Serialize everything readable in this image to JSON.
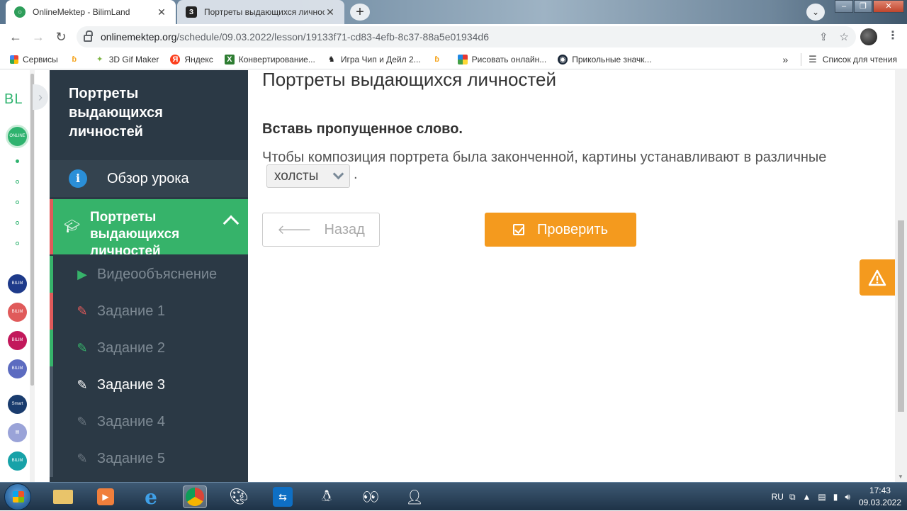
{
  "browser": {
    "tabs": [
      {
        "title": "OnlineMektep - BilimLand",
        "favicon": "onlinemektep-icon",
        "active": true
      },
      {
        "title": "Портреты выдающихся личносте",
        "favicon": "bilimland-icon",
        "active": false
      }
    ],
    "url_host": "onlinemektep.org",
    "url_path": "/schedule/09.03.2022/lesson/19133f71-cd83-4efb-8c37-88a5e01934d6",
    "bookmarks": [
      {
        "label": "Сервисы",
        "icon": "apps-grid-icon"
      },
      {
        "label": "",
        "icon": "bookmark-b-icon"
      },
      {
        "label": "3D Gif Maker",
        "icon": "gif-maker-icon"
      },
      {
        "label": "Яндекс",
        "icon": "yandex-icon"
      },
      {
        "label": "Конвертирование...",
        "icon": "convert-icon"
      },
      {
        "label": "Игра Чип и Дейл 2...",
        "icon": "chip-dale-icon"
      },
      {
        "label": "",
        "icon": "bookmark-b-icon"
      },
      {
        "label": "Рисовать онлайн...",
        "icon": "draw-online-icon"
      },
      {
        "label": "Прикольные значк...",
        "icon": "steam-icon"
      }
    ],
    "reading_list": "Список для чтения"
  },
  "rail": {
    "logo": "BL"
  },
  "sidebar": {
    "lesson_title": "Портреты выдающихся личностей",
    "overview": "Обзор урока",
    "active_section": "Портреты выдающихся личностей",
    "items": [
      {
        "label": "Видеообъяснение",
        "icon": "play-icon",
        "mark": "#36b36a",
        "icon_color": "#36b36a"
      },
      {
        "label": "Задание 1",
        "icon": "edit-icon",
        "mark": "#e05a5a",
        "icon_color": "#e05a5a"
      },
      {
        "label": "Задание 2",
        "icon": "edit-icon",
        "mark": "#36b36a",
        "icon_color": "#36b36a"
      },
      {
        "label": "Задание 3",
        "icon": "edit-icon",
        "mark": "#4a5865",
        "icon_color": "#ffffff",
        "current": true
      },
      {
        "label": "Задание 4",
        "icon": "edit-icon",
        "mark": "#4a5865",
        "icon_color": "#6d7882"
      },
      {
        "label": "Задание 5",
        "icon": "edit-icon",
        "mark": "#4a5865",
        "icon_color": "#6d7882"
      }
    ]
  },
  "main": {
    "title": "Портреты выдающихся личностей",
    "instruction": "Вставь пропущенное слово.",
    "sentence": "Чтобы композиция портрета была законченной, картины устанавливают в различные",
    "selected_answer": "холсты",
    "sentence_end": ".",
    "back_button": "Назад",
    "check_button": "Проверить"
  },
  "taskbar": {
    "lang": "RU",
    "time": "17:43",
    "date": "09.03.2022"
  },
  "colors": {
    "accent_green": "#36b36a",
    "accent_orange": "#f49a1e",
    "sidebar_bg": "#2b3945"
  }
}
